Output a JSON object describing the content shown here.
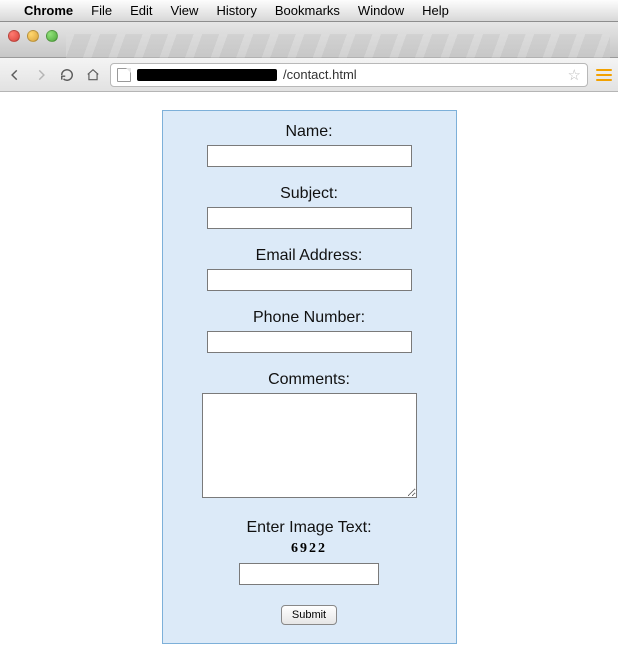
{
  "menubar": {
    "app": "Chrome",
    "items": [
      "File",
      "Edit",
      "View",
      "History",
      "Bookmarks",
      "Window",
      "Help"
    ]
  },
  "toolbar": {
    "url_visible_suffix": "/contact.html"
  },
  "form": {
    "fields": {
      "name": {
        "label": "Name:",
        "value": ""
      },
      "subject": {
        "label": "Subject:",
        "value": ""
      },
      "email": {
        "label": "Email Address:",
        "value": ""
      },
      "phone": {
        "label": "Phone Number:",
        "value": ""
      },
      "comments": {
        "label": "Comments:",
        "value": ""
      },
      "captcha": {
        "label": "Enter Image Text:",
        "code": "6922",
        "value": ""
      }
    },
    "submit_label": "Submit"
  }
}
